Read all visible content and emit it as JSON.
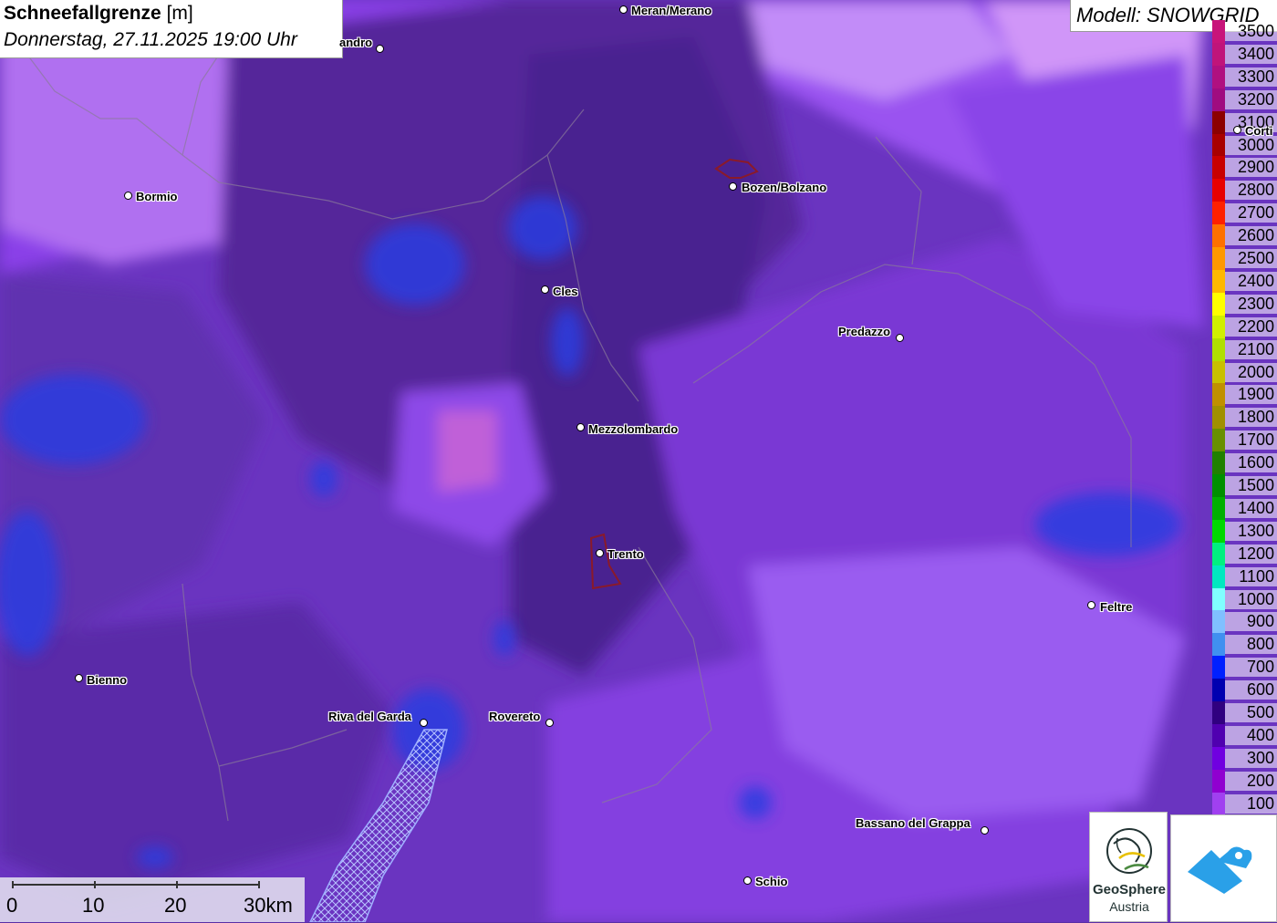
{
  "header": {
    "title_bold": "Schneefallgrenze",
    "title_unit": "[m]",
    "datetime": "Donnerstag, 27.11.2025 19:00 Uhr"
  },
  "model": {
    "label": "Modell: SNOWGRID"
  },
  "legend": {
    "items": [
      {
        "label": "3500",
        "color": "#c8147a"
      },
      {
        "label": "3400",
        "color": "#c0147a"
      },
      {
        "label": "3300",
        "color": "#b01080"
      },
      {
        "label": "3200",
        "color": "#a00c80"
      },
      {
        "label": "3100",
        "color": "#8c0000"
      },
      {
        "label": "3000",
        "color": "#a80000"
      },
      {
        "label": "2900",
        "color": "#c80000"
      },
      {
        "label": "2800",
        "color": "#e80000"
      },
      {
        "label": "2700",
        "color": "#ff2000"
      },
      {
        "label": "2600",
        "color": "#ff7000"
      },
      {
        "label": "2500",
        "color": "#ff9800"
      },
      {
        "label": "2400",
        "color": "#ffb800"
      },
      {
        "label": "2300",
        "color": "#ffff00"
      },
      {
        "label": "2200",
        "color": "#d0f000"
      },
      {
        "label": "2100",
        "color": "#b0e000"
      },
      {
        "label": "2000",
        "color": "#c8c000"
      },
      {
        "label": "1900",
        "color": "#c09000"
      },
      {
        "label": "1800",
        "color": "#a09000"
      },
      {
        "label": "1700",
        "color": "#689000"
      },
      {
        "label": "1600",
        "color": "#208000"
      },
      {
        "label": "1500",
        "color": "#009000"
      },
      {
        "label": "1400",
        "color": "#00b000"
      },
      {
        "label": "1300",
        "color": "#00d800"
      },
      {
        "label": "1200",
        "color": "#00f080"
      },
      {
        "label": "1100",
        "color": "#00e8c0"
      },
      {
        "label": "1000",
        "color": "#80ffff"
      },
      {
        "label": "900",
        "color": "#80c0ff"
      },
      {
        "label": "800",
        "color": "#4090f0"
      },
      {
        "label": "700",
        "color": "#0020ff"
      },
      {
        "label": "600",
        "color": "#0000b0"
      },
      {
        "label": "500",
        "color": "#300080"
      },
      {
        "label": "400",
        "color": "#5000b0"
      },
      {
        "label": "300",
        "color": "#7000e0"
      },
      {
        "label": "200",
        "color": "#9000d0"
      },
      {
        "label": "100",
        "color": "#a040f0"
      }
    ]
  },
  "cities": [
    {
      "name": "Meran/Merano"
    },
    {
      "name": "andro"
    },
    {
      "name": "Bormio"
    },
    {
      "name": "Bozen/Bolzano"
    },
    {
      "name": "Cles"
    },
    {
      "name": "Predazzo"
    },
    {
      "name": "Corti"
    },
    {
      "name": "Mezzolombardo"
    },
    {
      "name": "Trento"
    },
    {
      "name": "Feltre"
    },
    {
      "name": "Bienno"
    },
    {
      "name": "Riva del Garda"
    },
    {
      "name": "Rovereto"
    },
    {
      "name": "Bassano del Grappa"
    },
    {
      "name": "Schio"
    }
  ],
  "scale_bar": {
    "labels": [
      "0",
      "10",
      "20",
      "30km"
    ]
  },
  "logo": {
    "name": "GeoSphere",
    "sub": "Austria"
  },
  "colors": {
    "base_fill": "#5a2fa6",
    "water": "#1e3cd8"
  }
}
